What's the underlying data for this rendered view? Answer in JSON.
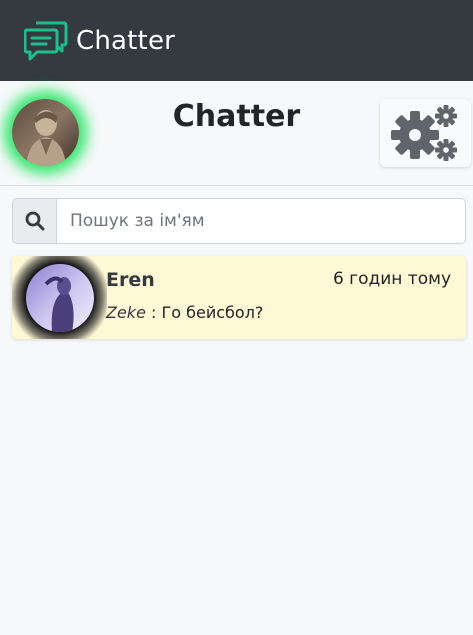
{
  "navbar": {
    "brand": "Chatter",
    "logo_icon": "chat-bubbles-icon",
    "logo_color": "#1bbf8a",
    "background": "#343a40"
  },
  "header": {
    "title": "Chatter",
    "avatar_glow_color": "#2ee86a",
    "settings_icon": "gears-icon"
  },
  "search": {
    "icon": "search-icon",
    "placeholder": "Пошук за ім'ям",
    "value": ""
  },
  "chats": [
    {
      "name": "Eren",
      "time": "6 годин тому",
      "last_sender": "Zeke",
      "separator": ":",
      "last_message": "Го бейсбол?",
      "highlight_color": "#fff8d5"
    }
  ]
}
